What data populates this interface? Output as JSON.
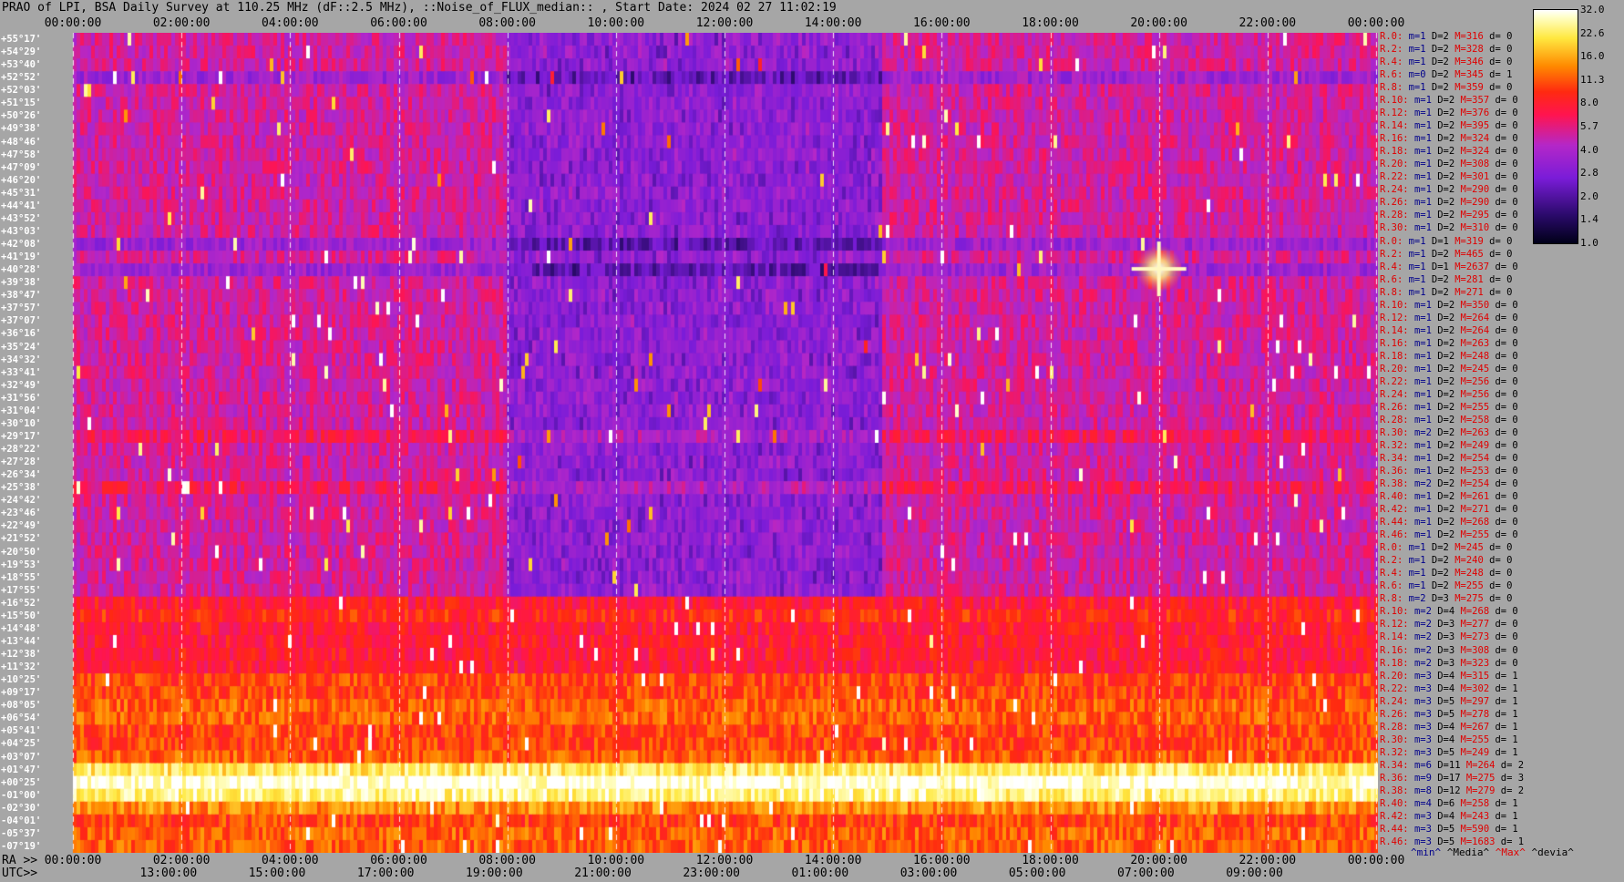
{
  "title": "PRAO of LPI, BSA Daily Survey at 110.25 MHz (dF::2.5 MHz), ::Noise_of_FLUX_median:: , Start Date: 2024 02 27 11:02:19",
  "chart_data": {
    "type": "heatmap",
    "title": "PRAO of LPI, BSA Daily Survey at 110.25 MHz (dF::2.5 MHz), ::Noise_of_FLUX_median:: , Start Date: 2024 02 27 11:02:19",
    "x_top_ticks": [
      "00:00:00",
      "02:00:00",
      "04:00:00",
      "06:00:00",
      "08:00:00",
      "10:00:00",
      "12:00:00",
      "14:00:00",
      "16:00:00",
      "18:00:00",
      "20:00:00",
      "22:00:00",
      "00:00:00"
    ],
    "ra_label": "RA >>",
    "ra_ticks": [
      "00:00:00",
      "02:00:00",
      "04:00:00",
      "06:00:00",
      "08:00:00",
      "10:00:00",
      "12:00:00",
      "14:00:00",
      "16:00:00",
      "18:00:00",
      "20:00:00",
      "22:00:00",
      "00:00:00"
    ],
    "utc_label": "UTC>>",
    "utc_ticks": [
      "13:00:00",
      "15:00:00",
      "17:00:00",
      "19:00:00",
      "21:00:00",
      "23:00:00",
      "01:00:00",
      "03:00:00",
      "05:00:00",
      "07:00:00",
      "09:00:00"
    ],
    "dec_labels": [
      "+55°17'",
      "+54°29'",
      "+53°40'",
      "+52°52'",
      "+52°03'",
      "+51°15'",
      "+50°26'",
      "+49°38'",
      "+48°46'",
      "+47°58'",
      "+47°09'",
      "+46°20'",
      "+45°31'",
      "+44°41'",
      "+43°52'",
      "+43°03'",
      "+42°08'",
      "+41°19'",
      "+40°28'",
      "+39°38'",
      "+38°47'",
      "+37°57'",
      "+37°07'",
      "+36°16'",
      "+35°24'",
      "+34°32'",
      "+33°41'",
      "+32°49'",
      "+31°56'",
      "+31°04'",
      "+30°10'",
      "+29°17'",
      "+28°22'",
      "+27°28'",
      "+26°34'",
      "+25°38'",
      "+24°42'",
      "+23°46'",
      "+22°49'",
      "+21°52'",
      "+20°50'",
      "+19°53'",
      "+18°55'",
      "+17°55'",
      "+16°52'",
      "+15°50'",
      "+14°48'",
      "+13°44'",
      "+12°38'",
      "+11°32'",
      "+10°25'",
      "+09°17'",
      "+08°05'",
      "+06°54'",
      "+05°41'",
      "+04°25'",
      "+03°07'",
      "+01°47'",
      "+00°25'",
      "-01°00'",
      "-02°30'",
      "-04°01'",
      "-05°37'",
      "-07°19'"
    ],
    "row_stats": [
      {
        "r": "R.0:",
        "m": "1",
        "d": "2",
        "h": "316",
        "dev": "0"
      },
      {
        "r": "R.2:",
        "m": "1",
        "d": "2",
        "h": "328",
        "dev": "0"
      },
      {
        "r": "R.4:",
        "m": "1",
        "d": "2",
        "h": "346",
        "dev": "0"
      },
      {
        "r": "R.6:",
        "m": "0",
        "d": "2",
        "h": "345",
        "dev": "1"
      },
      {
        "r": "R.8:",
        "m": "1",
        "d": "2",
        "h": "359",
        "dev": "0"
      },
      {
        "r": "R.10:",
        "m": "1",
        "d": "2",
        "h": "357",
        "dev": "0"
      },
      {
        "r": "R.12:",
        "m": "1",
        "d": "2",
        "h": "376",
        "dev": "0"
      },
      {
        "r": "R.14:",
        "m": "1",
        "d": "2",
        "h": "395",
        "dev": "0"
      },
      {
        "r": "R.16:",
        "m": "1",
        "d": "2",
        "h": "324",
        "dev": "0"
      },
      {
        "r": "R.18:",
        "m": "1",
        "d": "2",
        "h": "324",
        "dev": "0"
      },
      {
        "r": "R.20:",
        "m": "1",
        "d": "2",
        "h": "308",
        "dev": "0"
      },
      {
        "r": "R.22:",
        "m": "1",
        "d": "2",
        "h": "301",
        "dev": "0"
      },
      {
        "r": "R.24:",
        "m": "1",
        "d": "2",
        "h": "290",
        "dev": "0"
      },
      {
        "r": "R.26:",
        "m": "1",
        "d": "2",
        "h": "290",
        "dev": "0"
      },
      {
        "r": "R.28:",
        "m": "1",
        "d": "2",
        "h": "295",
        "dev": "0"
      },
      {
        "r": "R.30:",
        "m": "1",
        "d": "2",
        "h": "310",
        "dev": "0"
      },
      {
        "r": "R.0:",
        "m": "1",
        "d": "1",
        "h": "319",
        "dev": "0"
      },
      {
        "r": "R.2:",
        "m": "1",
        "d": "2",
        "h": "465",
        "dev": "0"
      },
      {
        "r": "R.4:",
        "m": "1",
        "d": "1",
        "h": "2637",
        "dev": "0"
      },
      {
        "r": "R.6:",
        "m": "1",
        "d": "2",
        "h": "281",
        "dev": "0"
      },
      {
        "r": "R.8:",
        "m": "1",
        "d": "2",
        "h": "271",
        "dev": "0"
      },
      {
        "r": "R.10:",
        "m": "1",
        "d": "2",
        "h": "350",
        "dev": "0"
      },
      {
        "r": "R.12:",
        "m": "1",
        "d": "2",
        "h": "264",
        "dev": "0"
      },
      {
        "r": "R.14:",
        "m": "1",
        "d": "2",
        "h": "264",
        "dev": "0"
      },
      {
        "r": "R.16:",
        "m": "1",
        "d": "2",
        "h": "263",
        "dev": "0"
      },
      {
        "r": "R.18:",
        "m": "1",
        "d": "2",
        "h": "248",
        "dev": "0"
      },
      {
        "r": "R.20:",
        "m": "1",
        "d": "2",
        "h": "245",
        "dev": "0"
      },
      {
        "r": "R.22:",
        "m": "1",
        "d": "2",
        "h": "256",
        "dev": "0"
      },
      {
        "r": "R.24:",
        "m": "1",
        "d": "2",
        "h": "256",
        "dev": "0"
      },
      {
        "r": "R.26:",
        "m": "1",
        "d": "2",
        "h": "255",
        "dev": "0"
      },
      {
        "r": "R.28:",
        "m": "1",
        "d": "2",
        "h": "258",
        "dev": "0"
      },
      {
        "r": "R.30:",
        "m": "2",
        "d": "2",
        "h": "263",
        "dev": "0"
      },
      {
        "r": "R.32:",
        "m": "1",
        "d": "2",
        "h": "249",
        "dev": "0"
      },
      {
        "r": "R.34:",
        "m": "1",
        "d": "2",
        "h": "254",
        "dev": "0"
      },
      {
        "r": "R.36:",
        "m": "1",
        "d": "2",
        "h": "253",
        "dev": "0"
      },
      {
        "r": "R.38:",
        "m": "2",
        "d": "2",
        "h": "254",
        "dev": "0"
      },
      {
        "r": "R.40:",
        "m": "1",
        "d": "2",
        "h": "261",
        "dev": "0"
      },
      {
        "r": "R.42:",
        "m": "1",
        "d": "2",
        "h": "271",
        "dev": "0"
      },
      {
        "r": "R.44:",
        "m": "1",
        "d": "2",
        "h": "268",
        "dev": "0"
      },
      {
        "r": "R.46:",
        "m": "1",
        "d": "2",
        "h": "255",
        "dev": "0"
      },
      {
        "r": "R.0:",
        "m": "1",
        "d": "2",
        "h": "245",
        "dev": "0"
      },
      {
        "r": "R.2:",
        "m": "1",
        "d": "2",
        "h": "240",
        "dev": "0"
      },
      {
        "r": "R.4:",
        "m": "1",
        "d": "2",
        "h": "248",
        "dev": "0"
      },
      {
        "r": "R.6:",
        "m": "1",
        "d": "2",
        "h": "255",
        "dev": "0"
      },
      {
        "r": "R.8:",
        "m": "2",
        "d": "3",
        "h": "275",
        "dev": "0"
      },
      {
        "r": "R.10:",
        "m": "2",
        "d": "4",
        "h": "268",
        "dev": "0"
      },
      {
        "r": "R.12:",
        "m": "2",
        "d": "3",
        "h": "277",
        "dev": "0"
      },
      {
        "r": "R.14:",
        "m": "2",
        "d": "3",
        "h": "273",
        "dev": "0"
      },
      {
        "r": "R.16:",
        "m": "2",
        "d": "3",
        "h": "308",
        "dev": "0"
      },
      {
        "r": "R.18:",
        "m": "2",
        "d": "3",
        "h": "323",
        "dev": "0"
      },
      {
        "r": "R.20:",
        "m": "3",
        "d": "4",
        "h": "315",
        "dev": "1"
      },
      {
        "r": "R.22:",
        "m": "3",
        "d": "4",
        "h": "302",
        "dev": "1"
      },
      {
        "r": "R.24:",
        "m": "3",
        "d": "5",
        "h": "297",
        "dev": "1"
      },
      {
        "r": "R.26:",
        "m": "3",
        "d": "5",
        "h": "278",
        "dev": "1"
      },
      {
        "r": "R.28:",
        "m": "3",
        "d": "4",
        "h": "267",
        "dev": "1"
      },
      {
        "r": "R.30:",
        "m": "3",
        "d": "4",
        "h": "255",
        "dev": "1"
      },
      {
        "r": "R.32:",
        "m": "3",
        "d": "5",
        "h": "249",
        "dev": "1"
      },
      {
        "r": "R.34:",
        "m": "6",
        "d": "11",
        "h": "264",
        "dev": "2"
      },
      {
        "r": "R.36:",
        "m": "9",
        "d": "17",
        "h": "275",
        "dev": "3"
      },
      {
        "r": "R.38:",
        "m": "8",
        "d": "12",
        "h": "279",
        "dev": "2"
      },
      {
        "r": "R.40:",
        "m": "4",
        "d": "6",
        "h": "258",
        "dev": "1"
      },
      {
        "r": "R.42:",
        "m": "3",
        "d": "4",
        "h": "243",
        "dev": "1"
      },
      {
        "r": "R.44:",
        "m": "3",
        "d": "5",
        "h": "590",
        "dev": "1"
      },
      {
        "r": "R.46:",
        "m": "3",
        "d": "5",
        "h": "1683",
        "dev": "1"
      }
    ],
    "stat_legend": [
      "^min^",
      "^Media^",
      "^Max^",
      "^devia^"
    ],
    "colorbar": {
      "ticks": [
        "32.0",
        "22.6",
        "16.0",
        "11.3",
        "8.0",
        "5.7",
        "4.0",
        "2.8",
        "2.0",
        "1.4",
        "1.0"
      ],
      "scale": "log",
      "range": [
        1.0,
        32.0
      ]
    }
  }
}
